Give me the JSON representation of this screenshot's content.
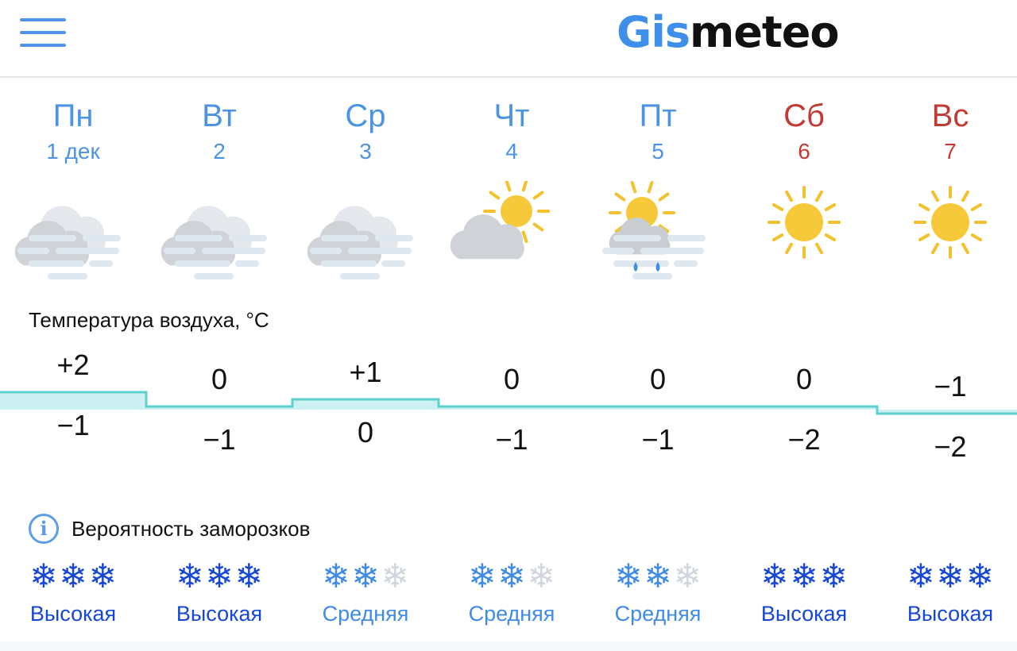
{
  "header": {
    "logo_part1": "Gis",
    "logo_part2": "meteo",
    "menu_icon": "hamburger-icon"
  },
  "days": [
    {
      "name": "Пн",
      "date": "1 дек",
      "weekend": false,
      "icon": "cloudy-fog",
      "max": "+2",
      "min": "−1",
      "frost_level": "Высокая",
      "frost_flakes": 3
    },
    {
      "name": "Вт",
      "date": "2",
      "weekend": false,
      "icon": "cloudy-fog",
      "max": "0",
      "min": "−1",
      "frost_level": "Высокая",
      "frost_flakes": 3
    },
    {
      "name": "Ср",
      "date": "3",
      "weekend": false,
      "icon": "cloudy-fog",
      "max": "+1",
      "min": "0",
      "frost_level": "Средняя",
      "frost_flakes": 2
    },
    {
      "name": "Чт",
      "date": "4",
      "weekend": false,
      "icon": "partly-cloudy",
      "max": "0",
      "min": "−1",
      "frost_level": "Средняя",
      "frost_flakes": 2
    },
    {
      "name": "Пт",
      "date": "5",
      "weekend": false,
      "icon": "sun-cloud-rain-fog",
      "max": "0",
      "min": "−1",
      "frost_level": "Средняя",
      "frost_flakes": 2
    },
    {
      "name": "Сб",
      "date": "6",
      "weekend": true,
      "icon": "sunny",
      "max": "0",
      "min": "−2",
      "frost_level": "Высокая",
      "frost_flakes": 3
    },
    {
      "name": "Вс",
      "date": "7",
      "weekend": true,
      "icon": "sunny",
      "max": "−1",
      "min": "−2",
      "frost_level": "Высокая",
      "frost_flakes": 3
    }
  ],
  "temperature": {
    "title": "Температура воздуха, °C",
    "max_values": [
      2,
      0,
      1,
      0,
      0,
      0,
      -1
    ],
    "min_values": [
      -1,
      -1,
      0,
      -1,
      -1,
      -2,
      -2
    ]
  },
  "frost": {
    "title": "Вероятность заморозков",
    "info_icon": "info-icon",
    "flake_glyph": "❄"
  },
  "colors": {
    "accent_blue": "#4d93e4",
    "weekend_red": "#c23a33",
    "frost_high": "#1747d6",
    "frost_mid": "#3f8be6",
    "temp_line": "#5fd0d0",
    "temp_fill": "#cdf1f3"
  }
}
